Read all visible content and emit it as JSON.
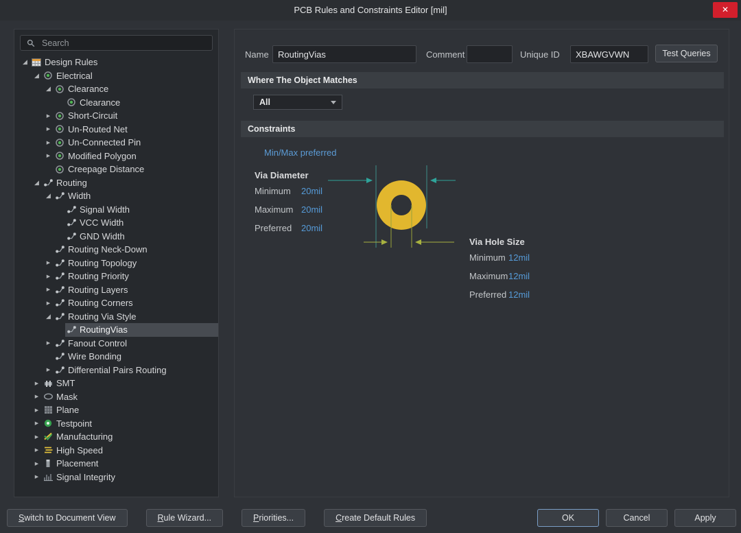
{
  "window": {
    "title": "PCB Rules and Constraints Editor [mil]",
    "close_glyph": "✕"
  },
  "search": {
    "placeholder": "Search"
  },
  "tree": {
    "items": [
      {
        "label": "Design Rules",
        "level": 0,
        "state": "expanded",
        "icon": "design-rules-icon",
        "selected": false
      },
      {
        "label": "Electrical",
        "level": 1,
        "state": "expanded",
        "icon": "electrical-rule-icon",
        "selected": false
      },
      {
        "label": "Clearance",
        "level": 2,
        "state": "expanded",
        "icon": "electrical-rule-icon",
        "selected": false
      },
      {
        "label": "Clearance",
        "level": 3,
        "state": "leaf",
        "icon": "electrical-rule-icon",
        "selected": false
      },
      {
        "label": "Short-Circuit",
        "level": 2,
        "state": "collapsed",
        "icon": "electrical-rule-icon",
        "selected": false
      },
      {
        "label": "Un-Routed Net",
        "level": 2,
        "state": "collapsed",
        "icon": "electrical-rule-icon",
        "selected": false
      },
      {
        "label": "Un-Connected Pin",
        "level": 2,
        "state": "collapsed",
        "icon": "electrical-rule-icon",
        "selected": false
      },
      {
        "label": "Modified Polygon",
        "level": 2,
        "state": "collapsed",
        "icon": "electrical-rule-icon",
        "selected": false
      },
      {
        "label": "Creepage Distance",
        "level": 2,
        "state": "leaf",
        "icon": "electrical-rule-icon",
        "selected": false
      },
      {
        "label": "Routing",
        "level": 1,
        "state": "expanded",
        "icon": "routing-rule-icon",
        "selected": false
      },
      {
        "label": "Width",
        "level": 2,
        "state": "expanded",
        "icon": "routing-rule-icon",
        "selected": false
      },
      {
        "label": "Signal Width",
        "level": 3,
        "state": "leaf",
        "icon": "routing-rule-icon",
        "selected": false
      },
      {
        "label": "VCC Width",
        "level": 3,
        "state": "leaf",
        "icon": "routing-rule-icon",
        "selected": false
      },
      {
        "label": "GND Width",
        "level": 3,
        "state": "leaf",
        "icon": "routing-rule-icon",
        "selected": false
      },
      {
        "label": "Routing Neck-Down",
        "level": 2,
        "state": "leaf",
        "icon": "routing-rule-icon",
        "selected": false
      },
      {
        "label": "Routing Topology",
        "level": 2,
        "state": "collapsed",
        "icon": "routing-rule-icon",
        "selected": false
      },
      {
        "label": "Routing Priority",
        "level": 2,
        "state": "collapsed",
        "icon": "routing-rule-icon",
        "selected": false
      },
      {
        "label": "Routing Layers",
        "level": 2,
        "state": "collapsed",
        "icon": "routing-rule-icon",
        "selected": false
      },
      {
        "label": "Routing Corners",
        "level": 2,
        "state": "collapsed",
        "icon": "routing-rule-icon",
        "selected": false
      },
      {
        "label": "Routing Via Style",
        "level": 2,
        "state": "expanded",
        "icon": "routing-rule-icon",
        "selected": false
      },
      {
        "label": "RoutingVias",
        "level": 3,
        "state": "leaf",
        "icon": "routing-rule-icon",
        "selected": true
      },
      {
        "label": "Fanout Control",
        "level": 2,
        "state": "collapsed",
        "icon": "routing-rule-icon",
        "selected": false
      },
      {
        "label": "Wire Bonding",
        "level": 2,
        "state": "leaf",
        "icon": "routing-rule-icon",
        "selected": false
      },
      {
        "label": "Differential Pairs Routing",
        "level": 2,
        "state": "collapsed",
        "icon": "routing-rule-icon",
        "selected": false
      },
      {
        "label": "SMT",
        "level": 1,
        "state": "collapsed",
        "icon": "smt-icon",
        "selected": false
      },
      {
        "label": "Mask",
        "level": 1,
        "state": "collapsed",
        "icon": "mask-icon",
        "selected": false
      },
      {
        "label": "Plane",
        "level": 1,
        "state": "collapsed",
        "icon": "plane-icon",
        "selected": false
      },
      {
        "label": "Testpoint",
        "level": 1,
        "state": "collapsed",
        "icon": "testpoint-icon",
        "selected": false
      },
      {
        "label": "Manufacturing",
        "level": 1,
        "state": "collapsed",
        "icon": "manufacturing-icon",
        "selected": false
      },
      {
        "label": "High Speed",
        "level": 1,
        "state": "collapsed",
        "icon": "high-speed-icon",
        "selected": false
      },
      {
        "label": "Placement",
        "level": 1,
        "state": "collapsed",
        "icon": "placement-icon",
        "selected": false
      },
      {
        "label": "Signal Integrity",
        "level": 1,
        "state": "collapsed",
        "icon": "signal-integrity-icon",
        "selected": false
      }
    ]
  },
  "form": {
    "name_label": "Name",
    "name_value": "RoutingVias",
    "comment_label": "Comment",
    "comment_value": "",
    "unique_id_label": "Unique ID",
    "unique_id_value": "XBAWGVWN",
    "test_queries_label": "Test Queries"
  },
  "sections": {
    "where": "Where The Object Matches",
    "constraints": "Constraints"
  },
  "scope": {
    "selected": "All"
  },
  "constraints": {
    "mode_link": "Min/Max preferred",
    "via_diameter": {
      "title": "Via Diameter",
      "rows": [
        {
          "label": "Minimum",
          "value": "20mil"
        },
        {
          "label": "Maximum",
          "value": "20mil"
        },
        {
          "label": "Preferred",
          "value": "20mil"
        }
      ]
    },
    "via_hole": {
      "title": "Via Hole Size",
      "rows": [
        {
          "label": "Minimum",
          "value": "12mil"
        },
        {
          "label": "Maximum",
          "value": "12mil"
        },
        {
          "label": "Preferred",
          "value": "12mil"
        }
      ]
    }
  },
  "footer": {
    "left": [
      {
        "label": "Switch to Document View",
        "underline_first": true
      },
      {
        "label": "Rule Wizard...",
        "underline_first": true
      },
      {
        "label": "Priorities...",
        "underline_first": true
      },
      {
        "label": "Create Default Rules",
        "underline_first": true
      }
    ],
    "right": [
      {
        "label": "OK",
        "default": true
      },
      {
        "label": "Cancel",
        "default": false
      },
      {
        "label": "Apply",
        "default": false
      }
    ]
  },
  "colors": {
    "accent_blue": "#569bd8",
    "via_gold": "#e2b72e",
    "arrow_teal": "#2fa39a",
    "arrow_olive": "#a8b240",
    "selection_bg": "#474b51",
    "close_red": "#d21f2c"
  }
}
